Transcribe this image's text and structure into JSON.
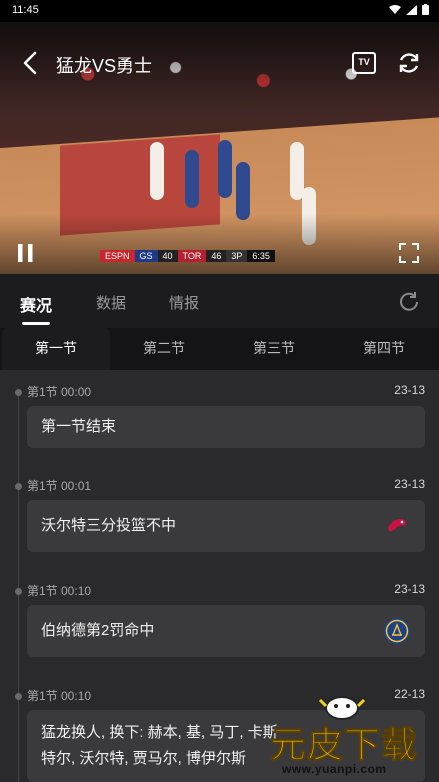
{
  "status_bar": {
    "time": "11:45"
  },
  "video": {
    "title": "猛龙VS勇士",
    "tv_label": "TV",
    "scorebug": {
      "network": "ESPN",
      "team_a": "GS",
      "score_a": "40",
      "team_b": "TOR",
      "score_b": "46",
      "clock": "6:35",
      "quarter": "3P"
    }
  },
  "tabs": [
    {
      "label": "赛况",
      "active": true
    },
    {
      "label": "数据",
      "active": false
    },
    {
      "label": "情报",
      "active": false
    }
  ],
  "periods": [
    {
      "label": "第一节",
      "active": true
    },
    {
      "label": "第二节",
      "active": false
    },
    {
      "label": "第三节",
      "active": false
    },
    {
      "label": "第四节",
      "active": false
    }
  ],
  "events": [
    {
      "meta": "第1节 00:00",
      "score": "23-13",
      "text": "第一节结束",
      "team": ""
    },
    {
      "meta": "第1节 00:01",
      "score": "23-13",
      "text": "沃尔特三分投篮不中",
      "team": "raptors-logo"
    },
    {
      "meta": "第1节 00:10",
      "score": "23-13",
      "text": "伯纳德第2罚命中",
      "team": "warriors-logo"
    },
    {
      "meta": "第1节 00:10",
      "score": "22-13",
      "text_line1": "猛龙换人, 换下: 赫本, 基, 马丁, 卡斯",
      "text_line2": "特尔, 沃尔特, 贾马尔, 博伊尔斯",
      "team": ""
    }
  ],
  "watermark": {
    "text": "元皮下载",
    "url": "www.yuanpi.com"
  },
  "colors": {
    "background": "#1c1c1e",
    "card": "#3a3a3c",
    "timeline_bg": "#2a2a2c",
    "watermark_yellow": "#f2d21a"
  }
}
